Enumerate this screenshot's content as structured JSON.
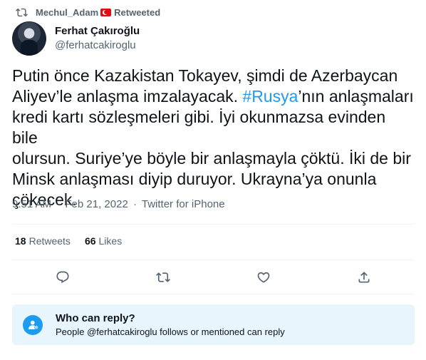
{
  "retweet": {
    "user": "Mechul_Adam",
    "label": "Retweeted"
  },
  "author": {
    "display_name": "Ferhat Çakıroğlu",
    "handle": "@ferhatcakiroglu"
  },
  "tweet": {
    "text_before": "Putin önce Kazakistan Tokayev, şimdi de Azerbaycan\nAliyev’le anlaşma imzalayacak. ",
    "hashtag": "#Rusya",
    "text_after": "’nın anlaşmaları\nkredi kartı sözleşmeleri gibi. İyi okunmazsa evinden bile\nolursun. Suriye’ye böyle bir anlaşmayla çöktü. İki de bir\nMinsk anlaşması diyip duruyor. Ukrayna’ya onunla\nçökecek."
  },
  "meta": {
    "time": "9:51 AM",
    "separator": "·",
    "date": "Feb 21, 2022",
    "source": "Twitter for iPhone"
  },
  "stats": {
    "retweets_count": "18",
    "retweets_label": "Retweets",
    "likes_count": "66",
    "likes_label": "Likes"
  },
  "actions": [
    "reply-icon",
    "retweet-icon",
    "like-icon",
    "share-icon"
  ],
  "reply_settings": {
    "title": "Who can reply?",
    "description": "People @ferhatcakiroglu follows or mentioned can reply"
  },
  "colors": {
    "accent": "#1d9bf0",
    "secondary_text": "#536471",
    "reply_box_bg": "#e8f5fd"
  }
}
